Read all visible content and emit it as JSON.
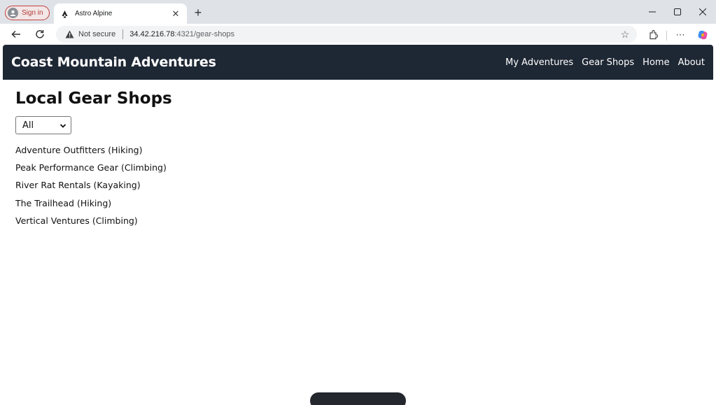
{
  "browser": {
    "signin_label": "Sign in",
    "tab_title": "Astro Alpine",
    "address": {
      "security_label": "Not secure",
      "url_host": "34.42.216.78",
      "url_path": ":4321/gear-shops"
    }
  },
  "site": {
    "brand": "Coast Mountain Adventures",
    "nav": [
      {
        "label": "My Adventures"
      },
      {
        "label": "Gear Shops"
      },
      {
        "label": "Home"
      },
      {
        "label": "About"
      }
    ]
  },
  "page": {
    "title": "Local Gear Shops",
    "filter": {
      "selected": "All"
    },
    "shops": [
      "Adventure Outfitters (Hiking)",
      "Peak Performance Gear (Climbing)",
      "River Rat Rentals (Kayaking)",
      "The Trailhead (Hiking)",
      "Vertical Ventures (Climbing)"
    ]
  },
  "colors": {
    "navbar_bg": "#1e2734",
    "titlebar_bg": "#dfe3e8",
    "signin_accent": "#c2413f"
  }
}
